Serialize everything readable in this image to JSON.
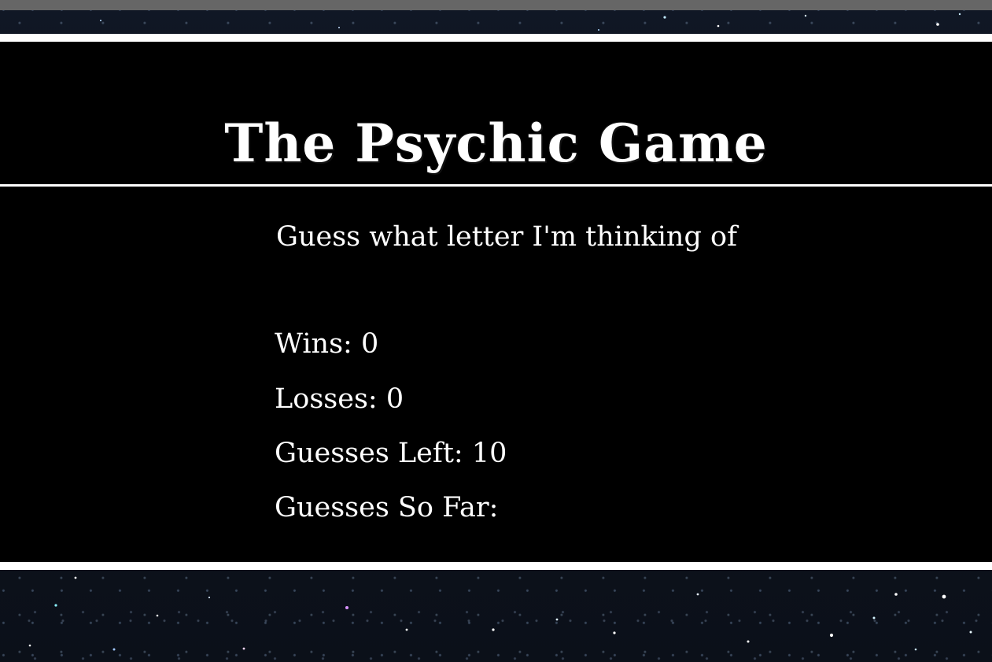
{
  "header": {
    "title": "The Psychic Game"
  },
  "game": {
    "instructions": "Guess what letter I'm thinking of",
    "stats": {
      "wins_label": "Wins: ",
      "wins_value": "0",
      "losses_label": "Losses: ",
      "losses_value": "0",
      "guesses_left_label": "Guesses Left: ",
      "guesses_left_value": "10",
      "guesses_so_far_label": "Guesses So Far:",
      "guesses_so_far_value": ""
    }
  },
  "theme": {
    "panel_background": "#000000",
    "panel_border": "#ffffff",
    "top_bar": "#666666",
    "page_background": "#0e1420",
    "text": "#ffffff"
  }
}
